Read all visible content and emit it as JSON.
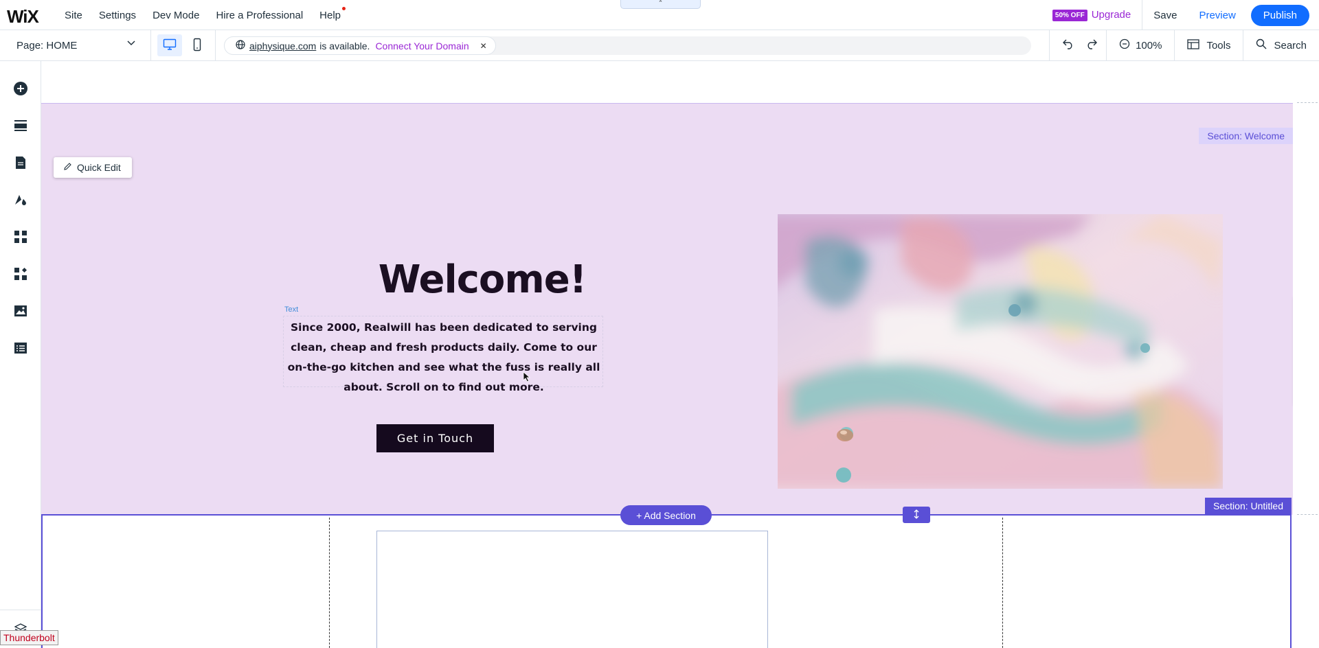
{
  "app": {
    "logo_text": "WiX",
    "collapse_glyph": "⌃"
  },
  "topnav": {
    "items": [
      "Site",
      "Settings",
      "Dev Mode",
      "Hire a Professional",
      "Help"
    ]
  },
  "topright": {
    "discount_badge": "50% OFF",
    "upgrade_label": "Upgrade",
    "save_label": "Save",
    "preview_label": "Preview",
    "publish_label": "Publish"
  },
  "secondbar": {
    "page_label": "Page: HOME",
    "domain_name": "aiphysique.com",
    "domain_status": "is available.",
    "connect_label": "Connect Your Domain",
    "zoom_label": "100%",
    "tools_label": "Tools",
    "search_label": "Search"
  },
  "icons": {
    "sidebar": [
      "add-icon",
      "sections-icon",
      "pages-icon",
      "design-icon",
      "apps-icon",
      "business-icon",
      "media-icon",
      "cms-icon",
      "layers-icon"
    ],
    "side_toolbar": [
      "arrow-up-icon",
      "arrow-down-icon",
      "pencil-icon",
      "layout-icon",
      "more-icon"
    ]
  },
  "canvas": {
    "section_welcome_label": "Section: Welcome",
    "quick_edit_label": "Quick Edit",
    "welcome_title": "Welcome!",
    "text_tag": "Text",
    "welcome_body": "Since 2000, Realwill has been dedicated to serving clean, cheap and fresh products daily. Come to our on-the-go kitchen and see what the fuss is really all about. Scroll on to find out more.",
    "cta_label": "Get in Touch",
    "add_section_label": "+ Add Section",
    "section_untitled_label": "Section: Untitled"
  },
  "overlay": {
    "thunderbolt_label": "Thunderbolt"
  },
  "colors": {
    "accent_blue": "#116dff",
    "upgrade_purple": "#9a27d5",
    "section_purple": "#5a4fd6",
    "welcome_bg": "#ecdcf3",
    "button_dark": "#150a1e"
  }
}
